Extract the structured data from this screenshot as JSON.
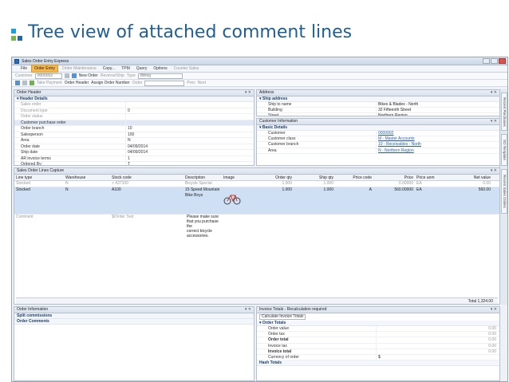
{
  "slide": {
    "title": "Tree view of attached comment lines"
  },
  "window": {
    "title": "Sales Order Entry Express"
  },
  "menu": [
    {
      "label": "File",
      "state": "normal"
    },
    {
      "label": "Order Entry",
      "state": "active"
    },
    {
      "label": "Order Maintenance",
      "state": "dim"
    },
    {
      "label": "Copy...",
      "state": "normal"
    },
    {
      "label": "TPM",
      "state": "normal"
    },
    {
      "label": "Query",
      "state": "normal"
    },
    {
      "label": "Options",
      "state": "normal"
    },
    {
      "label": "Counter Sales",
      "state": "dim"
    }
  ],
  "toolbar1": {
    "customer_label": "Customer",
    "customer_value": "0000002",
    "new_order": "New Order",
    "reverse_ship": "Reverse/Ship",
    "type_label": "Type",
    "type_value": "Billing"
  },
  "toolbar2": {
    "take_payment": "Take Payment",
    "order_header": "Order Header",
    "assign_order_number": "Assign Order Number",
    "order_label": "Order",
    "prev": "Prev",
    "next": "Next"
  },
  "order_header": {
    "title": "Order Header",
    "section": "Header Details",
    "fields": [
      {
        "label": "Sales order",
        "value": "",
        "dim": true
      },
      {
        "label": "Document type",
        "value": "0",
        "dim": true
      },
      {
        "label": "Order status",
        "value": "",
        "dim": true
      },
      {
        "label": "Customer purchase order",
        "value": "",
        "dim": false,
        "highlight": true
      },
      {
        "label": "Order branch",
        "value": "10",
        "dim": false
      },
      {
        "label": "Salesperson",
        "value": "100",
        "dim": false
      },
      {
        "label": "Area",
        "value": "N",
        "dim": false
      },
      {
        "label": "Order date",
        "value": "04/09/2014",
        "dim": false
      },
      {
        "label": "Ship date",
        "value": "04/09/2014",
        "dim": false
      },
      {
        "label": "AR invoice terms",
        "value": "1",
        "dim": false
      },
      {
        "label": "Ordered By:",
        "value": "T",
        "dim": false
      }
    ]
  },
  "address": {
    "title": "Address",
    "section": "Ship address",
    "fields": [
      {
        "label": "Ship to name",
        "value": "Bikes & Blades - North"
      },
      {
        "label": "Building",
        "value": "32 Fifteenth Street"
      },
      {
        "label": "Street",
        "value": "Northern Region"
      },
      {
        "label": "City",
        "value": "Richmond"
      }
    ]
  },
  "customer_info": {
    "title": "Customer Information",
    "section": "Basic Details",
    "fields": [
      {
        "label": "Customer",
        "value": "0000002",
        "link": true
      },
      {
        "label": "Customer class",
        "value": "M - Master Accounts",
        "link": true
      },
      {
        "label": "Customer branch",
        "value": "10 - Receivables - North",
        "link": true
      },
      {
        "label": "Area",
        "value": "N - Northern Region",
        "link": true
      }
    ]
  },
  "lines": {
    "title": "Sales Order Lines Capture",
    "headers": [
      "Line type",
      "Warehouse",
      "Stock code",
      "Description",
      "Image",
      "Order qty",
      "Ship qty",
      "Price code",
      "Price",
      "Price uom",
      "Net value"
    ],
    "rows": [
      {
        "line_type": "Stocked",
        "warehouse": "N",
        "stock_code": "> 437100",
        "description": "Bicycle Special",
        "order_qty": "1.000",
        "ship_qty": "1.000",
        "price_code": "",
        "price": "0.00000",
        "price_uom": "EA",
        "net_value": "0.00"
      },
      {
        "line_type": "Stocked",
        "warehouse": "N",
        "stock_code": "A100",
        "description": "15 Speed Mountain Bike Boys",
        "order_qty": "1.000",
        "ship_qty": "1.000",
        "price_code": "A",
        "price": "560.00000",
        "price_uom": "EA",
        "net_value": "560.00"
      }
    ],
    "comment": {
      "line_type": "Comment",
      "stock_code": "$/Order Text",
      "lines": [
        "Please make sure",
        "that you purchase",
        "the",
        "correct bicycle",
        "accessories."
      ]
    },
    "total_label": "Total",
    "total_value": "1,324.00"
  },
  "order_info": {
    "title": "Order Information",
    "items": [
      "Split commissions",
      "Order Comments"
    ]
  },
  "invoice_totals": {
    "title": "Invoice Totals - Recalculation required",
    "button": "Calculate Invoice Totals",
    "section": "Order Totals",
    "fields": [
      {
        "label": "Order value",
        "value": "0.00",
        "bold": false
      },
      {
        "label": "Order tax",
        "value": "0.00",
        "bold": false
      },
      {
        "label": "Order total",
        "value": "0.00",
        "bold": true
      },
      {
        "label": "Invoice tax",
        "value": "0.00",
        "bold": false
      },
      {
        "label": "Invoice total",
        "value": "0.00",
        "bold": true
      },
      {
        "label": "Currency of order",
        "value": "$",
        "bold": false
      }
    ],
    "section2": "Hash Totals"
  },
  "side_tabs": [
    "Recent Purchases",
    "SO Template",
    "Recent Sales Orders"
  ],
  "colors": {
    "title_blue": "#1f5f97",
    "active_menu": "#f7b84b",
    "selected_row": "#cfe0f5"
  }
}
